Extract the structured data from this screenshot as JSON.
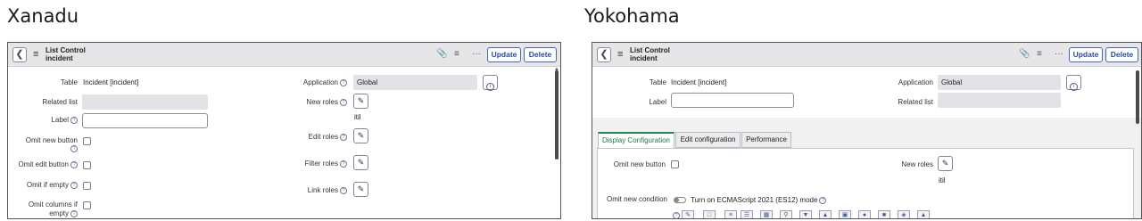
{
  "captions": {
    "left": "Xanadu",
    "right": "Yokohama"
  },
  "left": {
    "header": {
      "title": "List Control",
      "subtitle": "incident",
      "update": "Update",
      "delete": "Delete",
      "more": "···"
    },
    "table_label": "Table",
    "table_value": "Incident [incident]",
    "related_list_label": "Related list",
    "label_label": "Label",
    "omit_new_button_label": "Omit new button",
    "omit_edit_button_label": "Omit edit button",
    "omit_if_empty_label": "Omit if empty",
    "omit_columns_label_1": "Omit columns if",
    "omit_columns_label_2": "empty",
    "application_label": "Application",
    "application_value": "Global",
    "new_roles_label": "New roles",
    "new_roles_value": "itil",
    "edit_roles_label": "Edit roles",
    "filter_roles_label": "Filter roles",
    "link_roles_label": "Link roles"
  },
  "right": {
    "header": {
      "title": "List Control",
      "subtitle": "incident",
      "update": "Update",
      "delete": "Delete",
      "more": "···"
    },
    "table_label": "Table",
    "table_value": "Incident [incident]",
    "label_label": "Label",
    "application_label": "Application",
    "application_value": "Global",
    "related_list_label": "Related list",
    "tabs": [
      "Display Configuration",
      "Edit configuration",
      "Performance"
    ],
    "omit_new_button_label": "Omit new button",
    "new_roles_label": "New roles",
    "new_roles_value": "itil",
    "omit_new_condition_label": "Omit new condition",
    "es12_label": "Turn on ECMAScript 2021 (ES12) mode"
  },
  "colors": {
    "accent": "#1f8a4c",
    "button_border": "#4a65b5",
    "header_bg": "#e6e6e8"
  },
  "icons": [
    "back-icon",
    "hamburger-icon",
    "paperclip-icon",
    "settings-sliders-icon",
    "more-icon",
    "help-icon",
    "pencil-icon",
    "info-icon"
  ]
}
